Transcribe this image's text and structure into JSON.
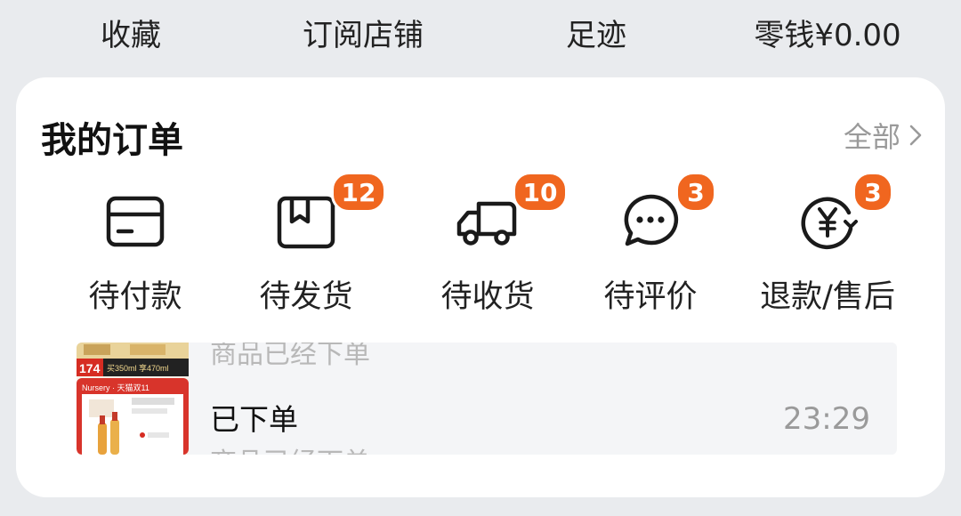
{
  "top_bar": {
    "items": [
      "收藏",
      "订阅店铺",
      "足迹",
      "零钱¥0.00"
    ]
  },
  "orders": {
    "title": "我的订单",
    "view_all": "全部",
    "items": [
      {
        "label": "待付款",
        "icon": "wallet-card-icon",
        "badge": ""
      },
      {
        "label": "待发货",
        "icon": "package-icon",
        "badge": "12"
      },
      {
        "label": "待收货",
        "icon": "delivery-truck-icon",
        "badge": "10"
      },
      {
        "label": "待评价",
        "icon": "chat-bubble-icon",
        "badge": "3"
      },
      {
        "label": "退款/售后",
        "icon": "yen-refund-icon",
        "badge": "3"
      }
    ]
  },
  "notice": {
    "previous_text": "商品已经下单",
    "status": "已下单",
    "description": "商品已经下单",
    "time": "23:29",
    "thumb_price": "174",
    "thumb_spec": "买350ml 享470ml",
    "thumb_brand": "Nursery · 天猫双11"
  },
  "colors": {
    "badge": "#f0661f",
    "background": "#e9ebee"
  }
}
